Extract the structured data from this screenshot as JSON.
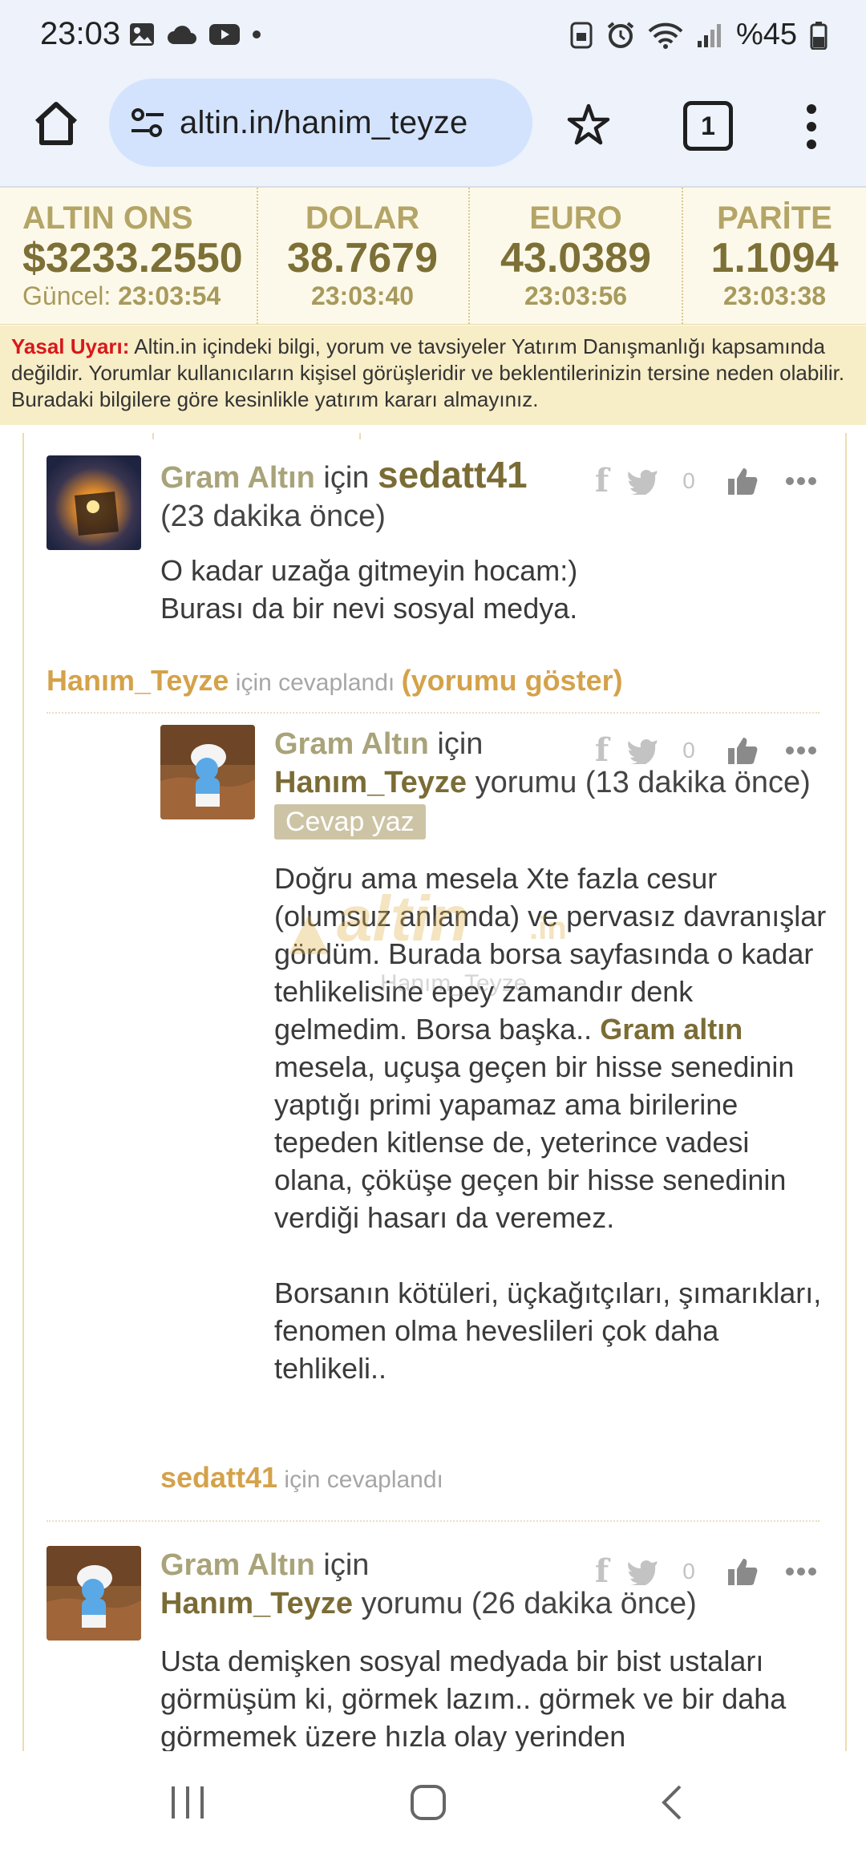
{
  "status": {
    "time": "23:03",
    "battery": "%45"
  },
  "browser": {
    "url": "altin.in/hanim_teyze",
    "tab_count": "1"
  },
  "ticker": [
    {
      "label": "ALTIN ONS",
      "value": "$3233.2550",
      "time_prefix": "Güncel: ",
      "time": "23:03:54"
    },
    {
      "label": "DOLAR",
      "value": "38.7679",
      "time_prefix": "",
      "time": "23:03:40"
    },
    {
      "label": "EURO",
      "value": "43.0389",
      "time_prefix": "",
      "time": "23:03:56"
    },
    {
      "label": "PARİTE",
      "value": "1.1094",
      "time_prefix": "",
      "time": "23:03:38"
    }
  ],
  "warning": {
    "title": "Yasal Uyarı:",
    "text": " Altin.in içindeki bilgi, yorum ve tavsiyeler Yatırım Danışmanlığı kapsamında değildir. Yorumlar kullanıcıların kişisel görüşleridir ve beklentilerinizin tersine neden olabilir. Buradaki bilgilere göre kesinlikle yatırım kararı almayınız."
  },
  "comments": [
    {
      "category": "Gram Altın",
      "for_word": " için ",
      "user": "sedatt41",
      "time": "(23 dakika önce)",
      "likes": "0",
      "body_line1": "O kadar uzağa gitmeyin hocam:)",
      "body_line2": "Burası da bir nevi sosyal medya.",
      "replied_user": "Hanım_Teyze",
      "replied_text": " için cevaplandı ",
      "show_text": "(yorumu göster)"
    },
    {
      "category": "Gram Altın",
      "for_word": " için",
      "user": "Hanım_Teyze",
      "time": " yorumu (13 dakika önce) ",
      "reply_chip": "Cevap yaz",
      "likes": "0",
      "body_p1_a": "Doğru ama mesela Xte fazla cesur (olumsuz anlamda) ve pervasız davranışlar gördüm. Burada borsa sayfasında o kadar tehlikelisine epey zamandır denk gelmedim. Borsa başka.. ",
      "body_p1_link": "Gram altın",
      "body_p1_b": " mesela, uçuşa geçen bir hisse senedinin yaptığı primi yapamaz ama birilerine tepeden kitlense de, yeterince vadesi olana, çöküşe geçen bir hisse senedinin verdiği hasarı da veremez.",
      "body_p2": "Borsanın kötüleri, üçkağıtçıları, şımarıkları, fenomen olma heveslileri çok daha tehlikeli..",
      "replied_user": "sedatt41",
      "replied_text": " için cevaplandı"
    },
    {
      "category": "Gram Altın",
      "for_word": " için",
      "user": "Hanım_Teyze",
      "time": " yorumu (26 dakika önce)",
      "likes": "0",
      "body": "Usta demişken sosyal medyada bir bist ustaları görmüşüm ki, görmek lazım.. görmek ve bir daha görmemek üzere hızla olay yerinden"
    }
  ],
  "watermark": {
    "brand": "altin",
    "suffix": ".in",
    "user": "Hanım_Teyze"
  },
  "colors": {
    "accent_gold": "#d4a24a",
    "brown": "#7a6c35",
    "warning_red": "#d8181a"
  }
}
